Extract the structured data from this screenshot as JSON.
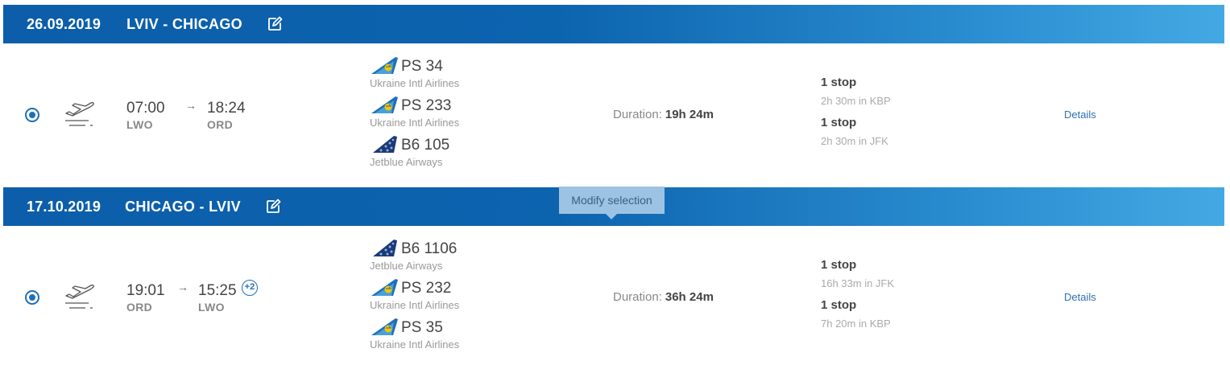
{
  "segments": [
    {
      "date": "26.09.2019",
      "route": "LVIV - CHICAGO",
      "departure_time": "07:00",
      "departure_code": "LWO",
      "arrival_time": "18:24",
      "arrival_code": "ORD",
      "day_offset": "",
      "flights": [
        {
          "number": "PS 34",
          "airline": "Ukraine Intl Airlines",
          "logo": "uia-tail-icon"
        },
        {
          "number": "PS 233",
          "airline": "Ukraine Intl Airlines",
          "logo": "uia-tail-icon"
        },
        {
          "number": "B6 105",
          "airline": "Jetblue Airways",
          "logo": "jetblue-tail-icon"
        }
      ],
      "duration_label": "Duration:",
      "duration": "19h 24m",
      "stops": [
        {
          "label": "1 stop",
          "detail": "2h 30m in KBP"
        },
        {
          "label": "1 stop",
          "detail": "2h 30m in JFK"
        }
      ],
      "details_label": "Details"
    },
    {
      "date": "17.10.2019",
      "route": "CHICAGO - LVIV",
      "departure_time": "19:01",
      "departure_code": "ORD",
      "arrival_time": "15:25",
      "arrival_code": "LWO",
      "day_offset": "+2",
      "flights": [
        {
          "number": "B6 1106",
          "airline": "Jetblue Airways",
          "logo": "jetblue-tail-icon"
        },
        {
          "number": "PS 232",
          "airline": "Ukraine Intl Airlines",
          "logo": "uia-tail-icon"
        },
        {
          "number": "PS 35",
          "airline": "Ukraine Intl Airlines",
          "logo": "uia-tail-icon"
        }
      ],
      "duration_label": "Duration:",
      "duration": "36h 24m",
      "stops": [
        {
          "label": "1 stop",
          "detail": "16h 33m in JFK"
        },
        {
          "label": "1 stop",
          "detail": "7h 20m in KBP"
        }
      ],
      "details_label": "Details"
    }
  ],
  "tooltip": {
    "text": "Modify selection"
  },
  "colors": {
    "header_start": "#0c5eaa",
    "header_end": "#43a9e3",
    "accent": "#1d6fb8",
    "uia_yellow": "#f5c400",
    "uia_blue": "#1d6fb8"
  }
}
